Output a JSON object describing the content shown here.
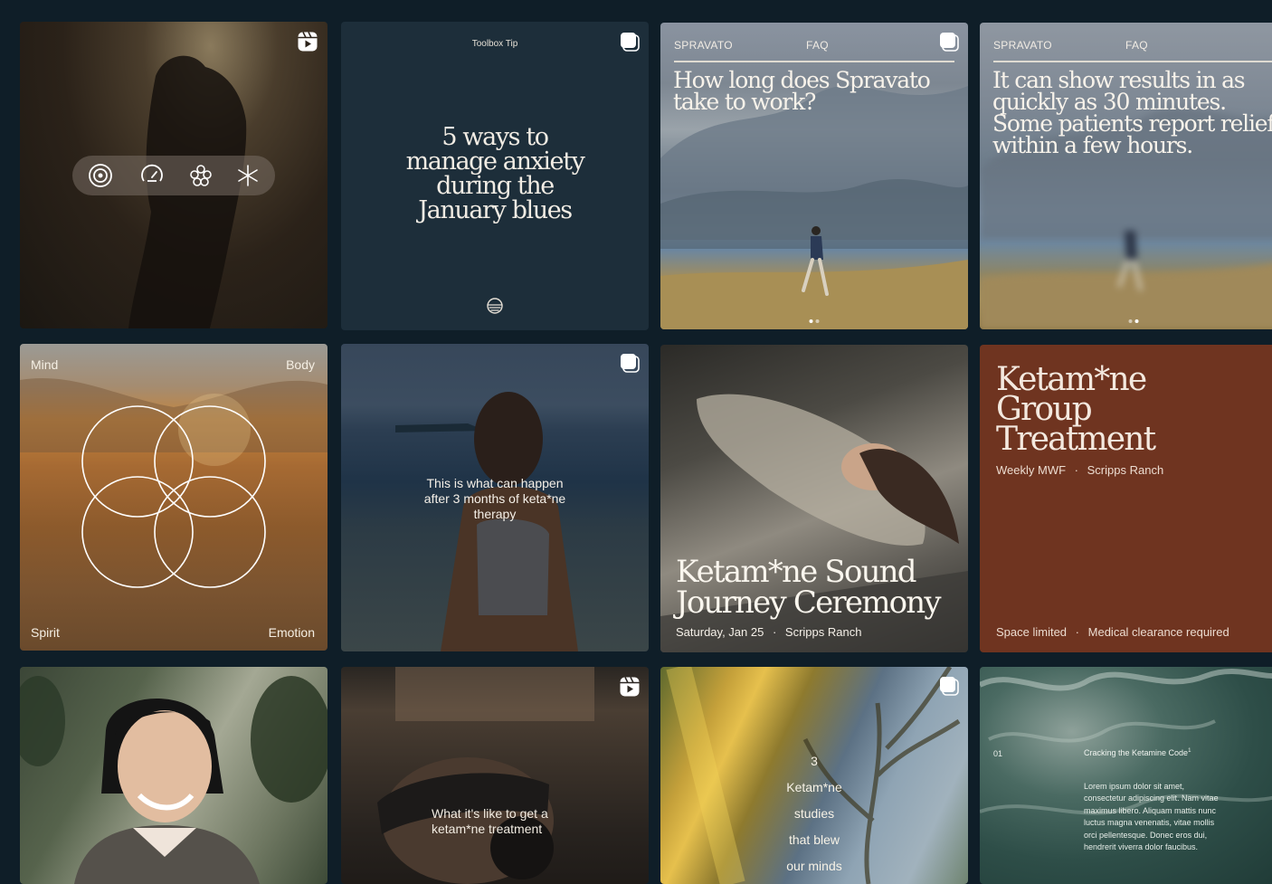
{
  "tiles": {
    "runner_video": {
      "icons": [
        "target-icon",
        "gauge-icon",
        "flower-icon",
        "sparkle-icon"
      ]
    },
    "toolbox_tip": {
      "label": "Toolbox Tip",
      "title": "5 ways to manage anxiety during the January blues"
    },
    "spravato_q": {
      "tag": "SPRAVATO",
      "tag2": "FAQ",
      "question": "How long does Spravato take to work?"
    },
    "spravato_a": {
      "tag": "SPRAVATO",
      "tag2": "FAQ",
      "answer": "It can show results in as quickly as 30 minutes. Some patients report relief within a few hours."
    },
    "venn": {
      "top_left": "Mind",
      "top_right": "Body",
      "bottom_left": "Spirit",
      "bottom_right": "Emotion"
    },
    "therapy_story": {
      "caption": "This is what can happen after 3 months of keta*ne therapy"
    },
    "sound_journey": {
      "title": "Ketam*ne Sound Journey Ceremony",
      "date": "Saturday, Jan 25",
      "location": "Scripps Ranch"
    },
    "group_treatment": {
      "title": "Ketam*ne Group Treatment",
      "schedule": "Weekly MWF",
      "location": "Scripps Ranch",
      "note1": "Space limited",
      "note2": "Medical clearance required"
    },
    "treatment_video": {
      "caption": "What it's like to get a ketam*ne treatment"
    },
    "studies": {
      "line1": "3",
      "line2": "Ketam*ne",
      "line3": "studies",
      "line4": "that blew",
      "line5": "our minds"
    },
    "cracking": {
      "number": "01",
      "title": "Cracking the Ketamine Code",
      "superscript": "1",
      "body": "Lorem ipsum dolor sit amet, consectetur adipiscing elit. Nam vitae maximus libero. Aliquam mattis nunc luctus magna venenatis, vitae mollis orci pellentesque. Donec eros dui, hendrerit viverra dolor faucibus."
    }
  }
}
